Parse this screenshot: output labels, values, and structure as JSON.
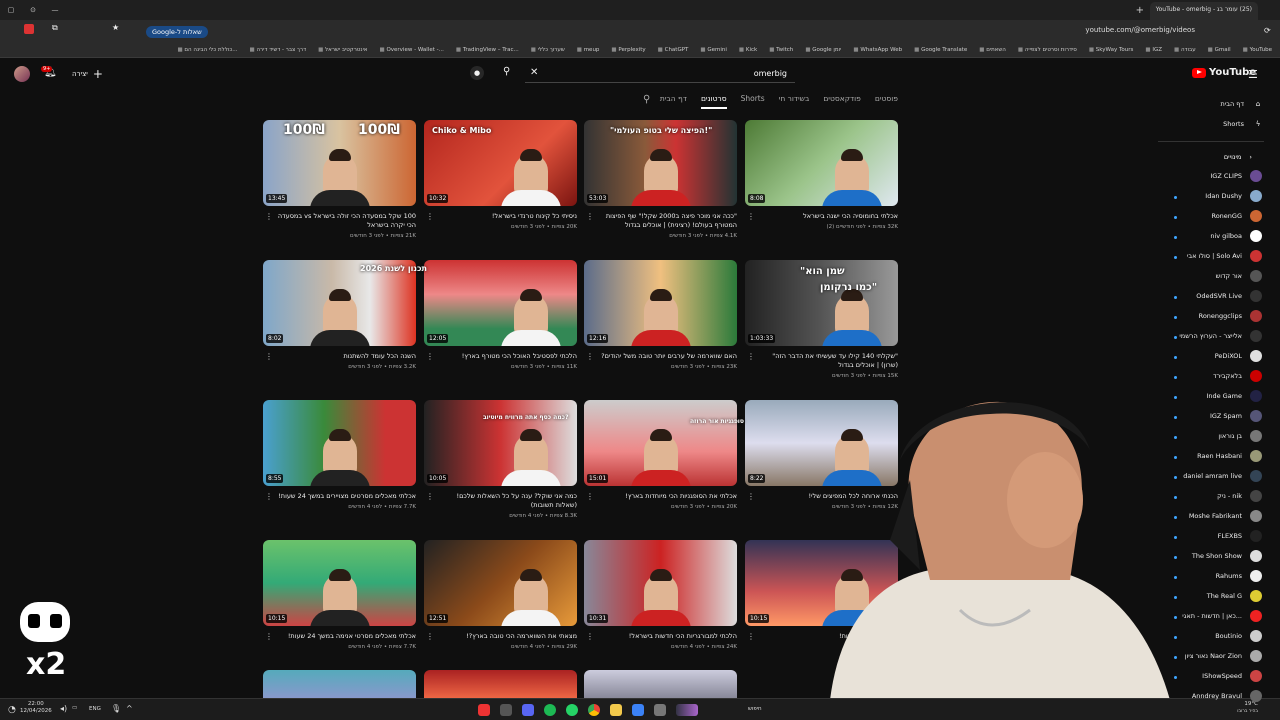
{
  "browser": {
    "tab_title": "(25) עומר בג - YouTube - omerbig",
    "url": "youtube.com/@omerbig/videos",
    "search_chip": "Google-שאלות ל",
    "bookmarks": [
      "YouTube",
      "Gmail",
      "עבודה",
      "IGZ",
      "SkyWay Tours",
      "סידרות וסרטים לצפייה",
      "השאתים",
      "Google Translate",
      "WhatsApp Web",
      "Google יומן",
      "Twitch",
      "Kick",
      "Gemini",
      "ChatGPT",
      "Perplexity",
      "meup",
      "שערוך כללי",
      "TradingView – Trac...",
      "Overview - Wallet -...",
      "אינטרקטיב ישראל",
      "דרך צבר - דשיד דירה",
      "כוללת כלי הבינה הם..."
    ]
  },
  "masthead": {
    "logo": "YouTube",
    "logo_country": "IL",
    "search_value": "omerbig",
    "create_label": "יצירה",
    "notification_count": "9+"
  },
  "channel_tabs": [
    "דף הבית",
    "סרטונים",
    "Shorts",
    "בשידור חי",
    "פודקאסטים",
    "פוסטים"
  ],
  "active_tab": "סרטונים",
  "videos": [
    {
      "title": "100 שקל במסעדה הכי זולה בישראל vs במסעדה הכי יקרה בישראל",
      "meta": "21K צפיות • לפני 3 חודשים",
      "duration": "13:45"
    },
    {
      "title": "ניסיתי כל קינוח טרנדי בישראל!",
      "meta": "20K צפיות • לפני 3 חודשים",
      "duration": "10:32"
    },
    {
      "title": "\"ככה אני מוכר פיצה ב2000 שקל!\" שף הפיצות המטורף בעולם! (רצינית) | אוכלים בגדול",
      "meta": "4.1K צפיות • לפני 3 חודשים",
      "duration": "53:03"
    },
    {
      "title": "אכלתי בחומוסיה הכי ישנה בישראל",
      "meta": "32K צפיות • לפני חודשיים (2)",
      "duration": "8:08"
    },
    {
      "title": "השנה הכל עומד להשתנות",
      "meta": "3.2K צפיות • לפני 3 חודשים",
      "duration": "8:02"
    },
    {
      "title": "הלכתי לפסטיבל האוכל הכי מטורף בארץ!",
      "meta": "11K צפיות • לפני 3 חודשים",
      "duration": "12:05"
    },
    {
      "title": "האם שווארמה של ערבים יותר טובה משל יהודים?",
      "meta": "23K צפיות • לפני 3 חודשים",
      "duration": "12:16"
    },
    {
      "title": "\"שקלתי 140 קילו עד שעשיתי את הדבר הזה\" (שרון) | אוכלים בגדול",
      "meta": "15K צפיות • לפני 3 חודשים",
      "duration": "1:03:33"
    },
    {
      "title": "אכלתי מאכלים מסרטים מצויירים במשך 24 שעות!",
      "meta": "7.7K צפיות • לפני 4 חודשים",
      "duration": "8:55"
    },
    {
      "title": "כמה אני שוקל? ענה על כל השאלות שלכם! (שאלות תשובות)",
      "meta": "8.3K צפיות • לפני 4 חודשים",
      "duration": "10:05"
    },
    {
      "title": "אכלתי את הסופגניות הכי מיוחדות בארץ!",
      "meta": "20K צפיות • לפני 3 חודשים",
      "duration": "15:01"
    },
    {
      "title": "הכנתי ארוחה לכל המפיצים שלי!",
      "meta": "12K צפיות • לפני 3 חודשים",
      "duration": "8:22"
    },
    {
      "title": "אכלתי מאכלים מסרטי אנימה במשך 24 שעות!",
      "meta": "7.7K צפיות • לפני 4 חודשים",
      "duration": "10:15"
    },
    {
      "title": "מצאתי את השווארמה הכי טובה בארץ?!",
      "meta": "29K צפיות • לפני 4 חודשים",
      "duration": "12:51"
    },
    {
      "title": "הלכתי למבורגריות הכי חדשות בישראל!",
      "meta": "24K צפיות • לפני 4 חודשים",
      "duration": "10:31"
    },
    {
      "title": "ירים במשך 24 שעות!",
      "meta": "",
      "duration": "10:15"
    }
  ],
  "thumb_texts": {
    "t1a": "100₪",
    "t1b": "100₪",
    "t2": "Chiko & Mibo",
    "t3": "\"הפיצה שלי בטופ העולמי!\"",
    "t5": "תכנון לשנת 2026",
    "t7a": "\"שמן הוא",
    "t7b": "כמו נרקומן\"",
    "t10": "כמה כסף אתה מרוויח מיוטיוב?",
    "t11": "סופגניות אור הרוזה"
  },
  "sidebar": {
    "home": "דף הבית",
    "shorts": "Shorts",
    "subs_header": "מינויים",
    "subscriptions": [
      "IGZ CLIPS",
      "Idan Dushy",
      "RonenGG",
      "niv gilboa",
      "סולו אבי | Solo Avi",
      "אור קדוש",
      "OdedSVR Live",
      "Ronenggclips",
      "אלייצר - הערוץ הרשמי",
      "PeDiXOL",
      "בלאקבירד",
      "Inde Game",
      "IGZ Spam",
      "בן גוראון",
      "Raen Hasbani",
      "daniel amram live",
      "ניק - nik",
      "Moshe Fabrikant",
      "FLEXBS",
      "The Shon Show",
      "Rahums",
      "The Real G",
      "כאן | חדשות - תאגי...",
      "Boutinio",
      "נאור ציון Naor Zion",
      "IShowSpeed",
      "Anndrey Bravul"
    ]
  },
  "taskbar": {
    "time": "22:00",
    "date": "12/04/2026",
    "lang": "ENG",
    "search_placeholder": "חיפוש",
    "weather": "19°C",
    "weather_text": "בהיר ברובו"
  },
  "colors": {
    "bg": "#0f0f0f",
    "accent": "#ff0000",
    "link": "#3ea6ff"
  }
}
